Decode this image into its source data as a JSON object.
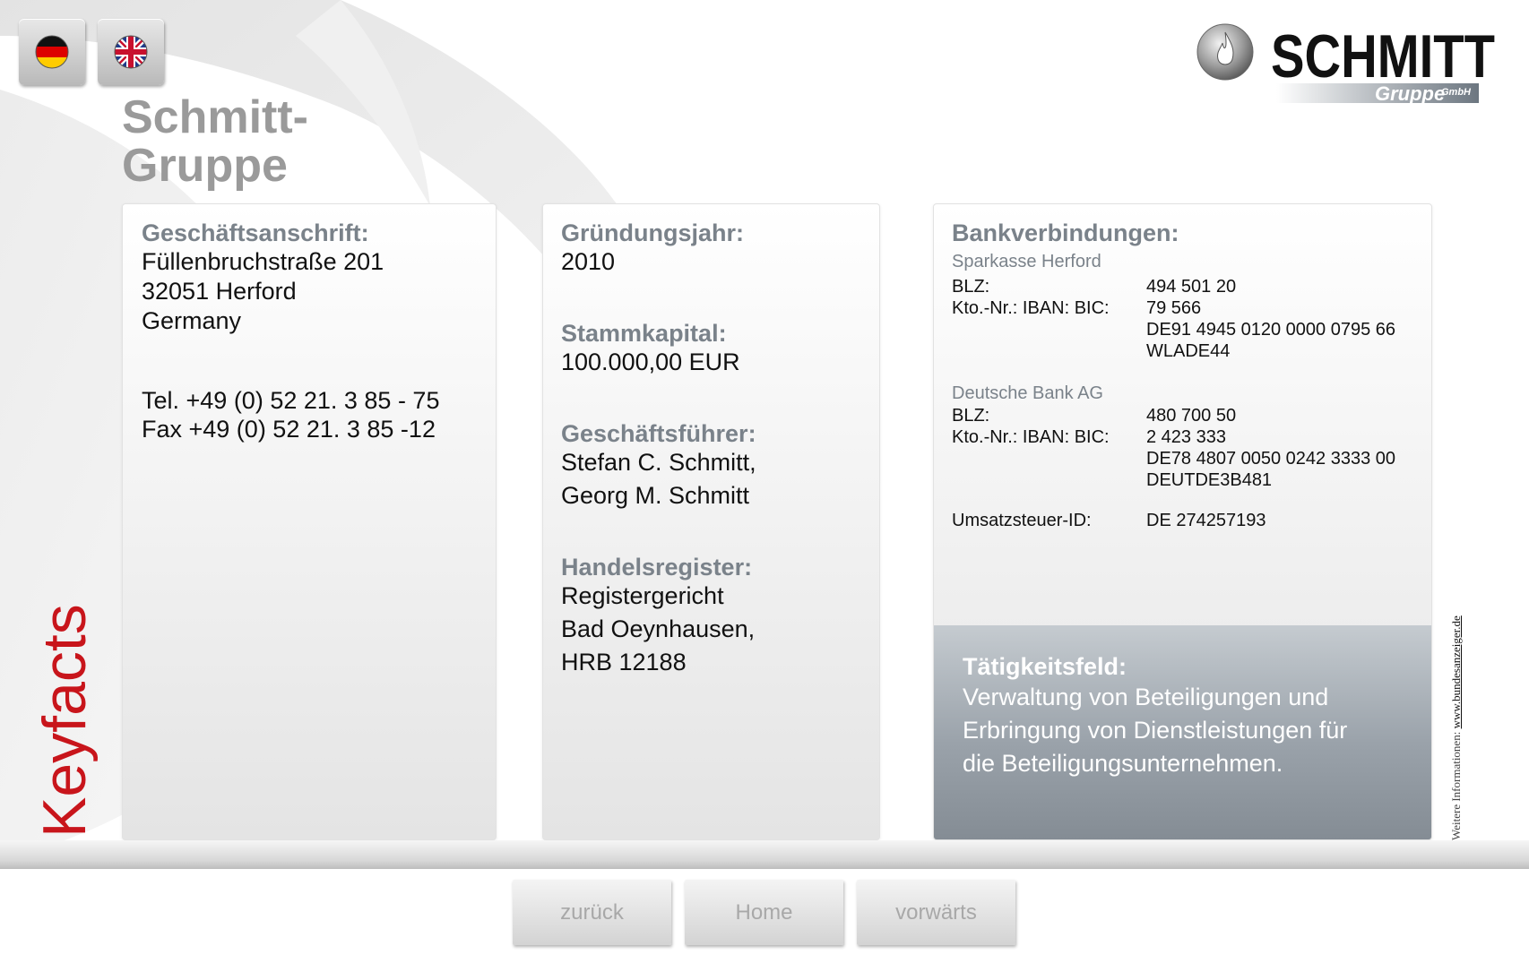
{
  "header": {
    "title": "Schmitt-\nGruppe",
    "lang_de_label": "Deutsch",
    "lang_en_label": "English",
    "logo_text": "SCHMITT",
    "logo_sub": "Gruppe",
    "logo_sub_small": "GmbH"
  },
  "address_card": {
    "heading": "Geschäftsanschrift:",
    "line1": "Füllenbruchstraße 201",
    "line2": "32051 Herford",
    "line3": "Germany",
    "tel": "Tel. +49 (0) 52 21. 3 85 - 75",
    "fax": "Fax +49 (0) 52 21. 3 85 -12"
  },
  "company_card": {
    "founded_heading": "Gründungsjahr:",
    "founded_value": "2010",
    "capital_heading": "Stammkapital:",
    "capital_value": "100.000,00 EUR",
    "ceo_heading": "Geschäftsführer:",
    "ceo_1": "Stefan C. Schmitt,",
    "ceo_2": "Georg M. Schmitt",
    "register_heading": "Handelsregister:",
    "register_1": "Registergericht",
    "register_2": "Bad Oeynhausen,",
    "register_3": "HRB 12188"
  },
  "bank_card": {
    "heading": "Bankverbindungen:",
    "banks": [
      {
        "name": "Sparkasse Herford",
        "blz_label": "BLZ:",
        "kto_label": "Kto.-Nr.: IBAN: BIC:",
        "blz": "494 501 20",
        "kto": "79 566",
        "iban": "DE91 4945 0120 0000 0795 66",
        "bic": "WLADE44"
      },
      {
        "name": "Deutsche  Bank AG",
        "blz_label": "BLZ:",
        "kto_label": "Kto.-Nr.: IBAN: BIC:",
        "blz": "480 700 50",
        "kto": "2 423 333",
        "iban": "DE78 4807 0050 0242 3333 00",
        "bic": "DEUTDE3B481"
      }
    ],
    "vat_label": "Umsatzsteuer-ID:",
    "vat_value": "DE 274257193",
    "activity_heading": "Tätigkeitsfeld:",
    "activity_1": "Verwaltung von Beteiligungen und",
    "activity_2": "Erbringung von Dienstleistungen für",
    "activity_3": "die Beteiligungsunternehmen."
  },
  "side": {
    "keyfacts": "Keyfacts",
    "note_prefix": "Weitere Informationen: ",
    "note_link": "www.bundesanzeiger.de"
  },
  "nav": {
    "back": "zurück",
    "home": "Home",
    "forward": "vorwärts"
  },
  "colors": {
    "accent_red": "#c8151b",
    "heading_grey": "#7a828a",
    "title_grey": "#9a9a9a"
  },
  "icons": {
    "lang_de": "germany-flag-icon",
    "lang_en": "uk-flag-icon",
    "logo_flame": "flame-icon"
  }
}
